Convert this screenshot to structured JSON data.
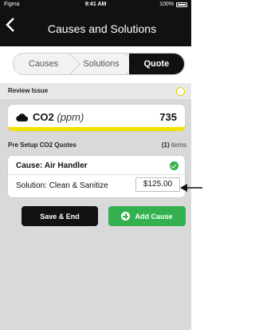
{
  "status_bar": {
    "carrier": "Figma",
    "time": "9:41 AM",
    "battery": "100%"
  },
  "nav": {
    "title": "Causes and Solutions",
    "back_icon": "chevron-left-icon"
  },
  "tabs": [
    {
      "label": "Causes",
      "active": false
    },
    {
      "label": "Solutions",
      "active": false
    },
    {
      "label": "Quote",
      "active": true
    }
  ],
  "review": {
    "label": "Review Issue",
    "status_color": "#f1cd00",
    "metric": "CO2",
    "unit": "(ppm)",
    "value": "735",
    "icon": "cloud-icon"
  },
  "quotes": {
    "label": "Pre Setup CO2 Quotes",
    "count": "(1)",
    "count_suffix": "items",
    "items": [
      {
        "cause": "Cause: Air Handler",
        "solution": "Solution: Clean & Sanitize",
        "price": "$125.00"
      }
    ]
  },
  "buttons": {
    "save": "Save & End",
    "add": "Add Cause"
  },
  "colors": {
    "accent_green": "#33b14e",
    "alert_yellow": "#f1e400",
    "dark": "#111111"
  }
}
